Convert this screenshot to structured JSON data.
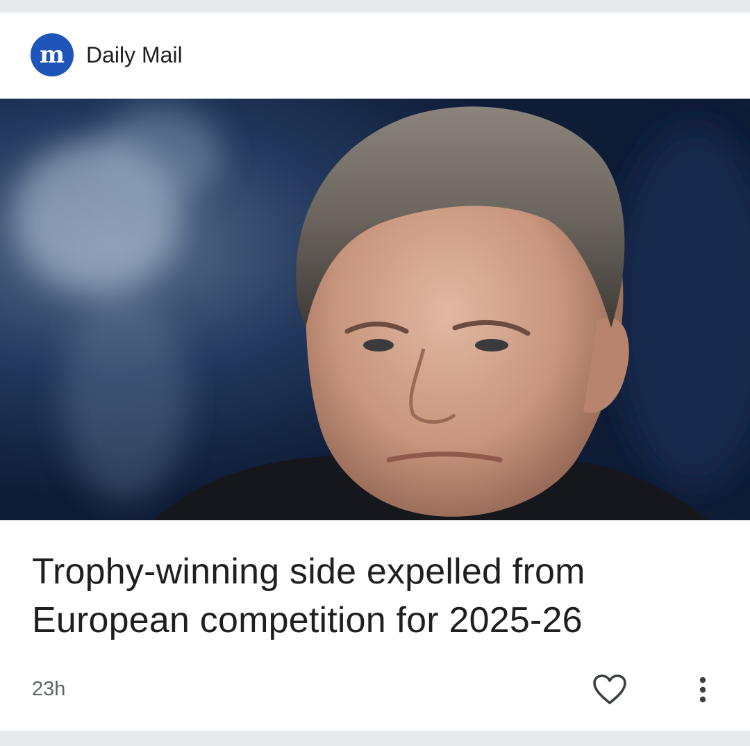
{
  "card": {
    "source": {
      "name": "Daily Mail",
      "logo_icon": "daily-mail-logo-icon",
      "logo_letter": "m",
      "logo_color": "#1f55b8"
    },
    "image": {
      "subject": "portrait-photo"
    },
    "headline": "Trophy-winning side expelled from European competition for 2025-26",
    "age": "23h",
    "actions": {
      "like_icon": "heart-outline-icon",
      "more_icon": "more-vertical-icon"
    }
  }
}
